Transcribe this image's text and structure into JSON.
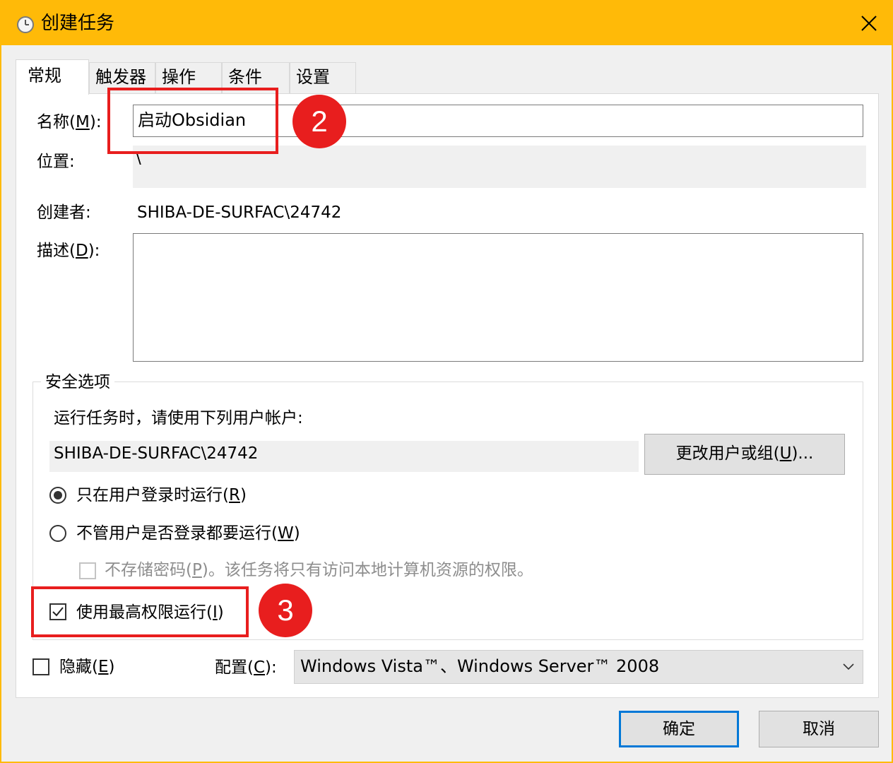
{
  "window": {
    "title": "创建任务",
    "icon": "clock-icon",
    "close_icon": "close-icon"
  },
  "tabs": [
    {
      "label": "常规",
      "active": true
    },
    {
      "label": "触发器",
      "active": false
    },
    {
      "label": "操作",
      "active": false
    },
    {
      "label": "条件",
      "active": false
    },
    {
      "label": "设置",
      "active": false
    }
  ],
  "general": {
    "name_label": "名称(M):",
    "name_label_pre": "名称(",
    "name_label_key": "M",
    "name_label_post": "):",
    "name_value": "启动Obsidian",
    "location_label": "位置:",
    "location_value": "\\",
    "author_label": "创建者:",
    "author_value": "SHIBA-DE-SURFAC\\24742",
    "description_label_pre": "描述(",
    "description_label_key": "D",
    "description_label_post": "):",
    "description_value": ""
  },
  "security": {
    "group_title": "安全选项",
    "run_as_text": "运行任务时，请使用下列用户帐户:",
    "user_account": "SHIBA-DE-SURFAC\\24742",
    "change_user_button": {
      "pre": "更改用户或组(",
      "key": "U",
      "post": ")..."
    },
    "radio_logged_on": {
      "pre": "只在用户登录时运行(",
      "key": "R",
      "post": ")",
      "checked": true
    },
    "radio_whether_logged_on": {
      "pre": "不管用户是否登录都要运行(",
      "key": "W",
      "post": ")",
      "checked": false
    },
    "no_store_password": {
      "pre": "不存储密码(",
      "key": "P",
      "post": ")。该任务将只有访问本地计算机资源的权限。",
      "checked": false,
      "disabled": true
    },
    "highest_privileges": {
      "pre": "使用最高权限运行(",
      "key": "I",
      "post": ")",
      "checked": true
    }
  },
  "bottom": {
    "hidden": {
      "pre": "隐藏(",
      "key": "E",
      "post": ")",
      "checked": false
    },
    "configure_label": {
      "pre": "配置(",
      "key": "C",
      "post": "):"
    },
    "configure_value": "Windows Vista™、Windows Server™ 2008",
    "dropdown_icon": "chevron-down-icon"
  },
  "buttons": {
    "ok": "确定",
    "cancel": "取消"
  },
  "annotations": {
    "badge_2": "2",
    "badge_3": "3",
    "color": "#e81e1e"
  },
  "colors": {
    "titlebar": "#ffba08",
    "focus": "#0078d7"
  }
}
